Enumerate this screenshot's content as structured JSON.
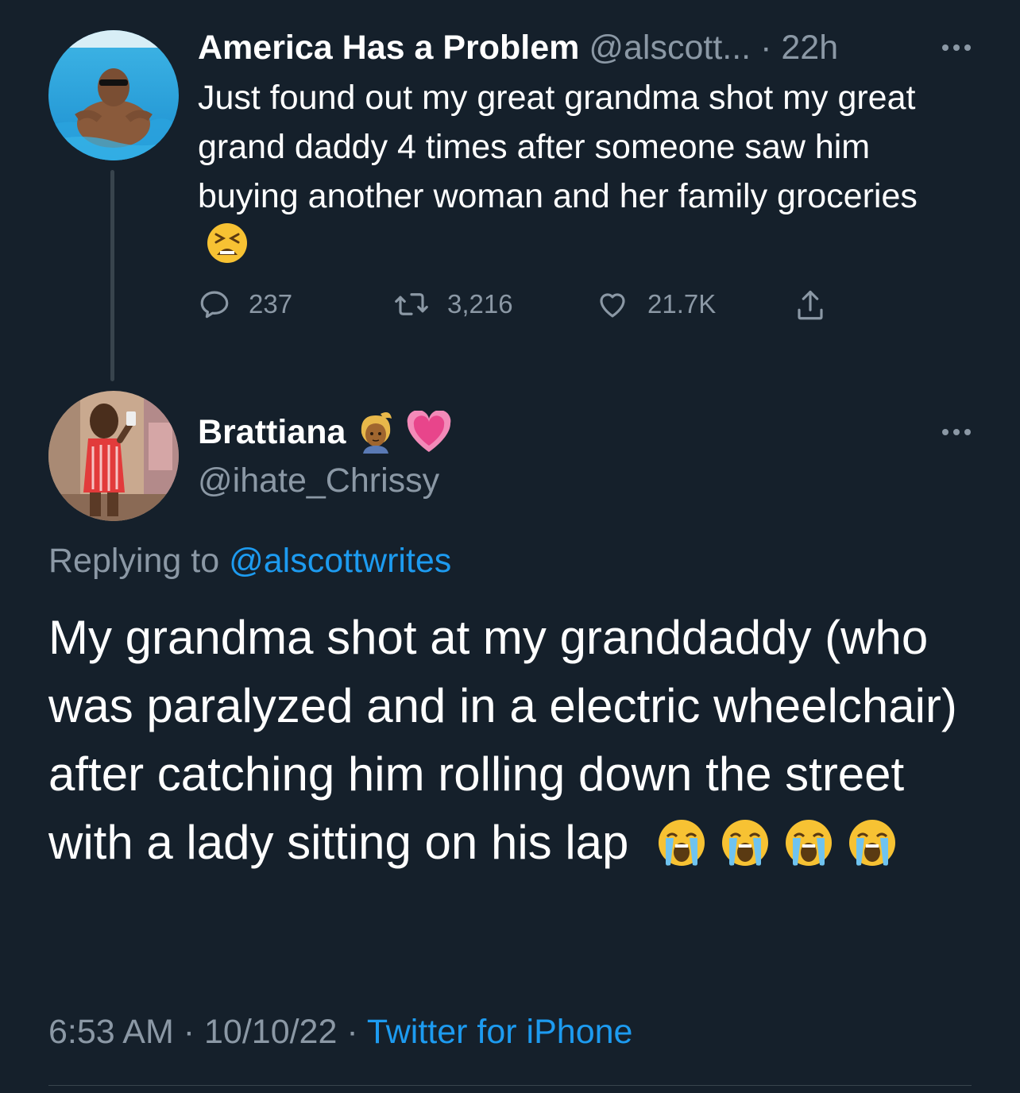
{
  "tweet1": {
    "name": "America Has a Problem",
    "handle": "@alscott...",
    "separator": "·",
    "time": "22h",
    "text": "Just found out my great grandma shot my great grand daddy 4 times after someone saw him buying another woman and her family groceries",
    "emoji": "tired-face-emoji",
    "reply_count": "237",
    "retweet_count": "3,216",
    "like_count": "21.7K"
  },
  "tweet2": {
    "name": "Brattiana",
    "name_emojis": [
      "woman-blond-hair-emoji",
      "growing-heart-emoji"
    ],
    "handle": "@ihate_Chrissy",
    "replying_prefix": "Replying to",
    "replying_handle": "@alscottwrites",
    "text": "My grandma shot at my granddaddy (who was paralyzed and in a electric wheelchair) after catching him rolling down the street with a lady sitting on his lap",
    "emojis": [
      "loudly-crying-face",
      "loudly-crying-face",
      "loudly-crying-face",
      "loudly-crying-face"
    ],
    "time": "6:53 AM",
    "sep1": "·",
    "date": "10/10/22",
    "sep2": "·",
    "source": "Twitter for iPhone"
  },
  "colors": {
    "background": "#15202b",
    "text": "#ffffff",
    "muted": "#8b98a5",
    "link": "#1d9bf0",
    "divider": "#38444d"
  }
}
